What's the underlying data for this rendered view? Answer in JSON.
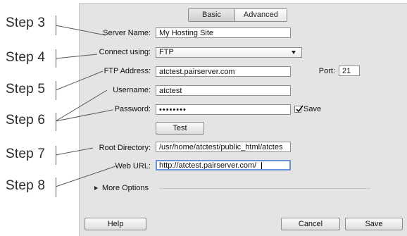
{
  "steps": [
    "Step 3",
    "Step 4",
    "Step 5",
    "Step 6",
    "Step 7",
    "Step 8"
  ],
  "tabs": {
    "basic": "Basic",
    "advanced": "Advanced"
  },
  "form": {
    "server_name_label": "Server Name:",
    "server_name_value": "My Hosting Site",
    "connect_using_label": "Connect using:",
    "connect_using_value": "FTP",
    "ftp_address_label": "FTP Address:",
    "ftp_address_value": "atctest.pairserver.com",
    "port_label": "Port:",
    "port_value": "21",
    "username_label": "Username:",
    "username_value": "atctest",
    "password_label": "Password:",
    "password_value": "••••••••",
    "save_label": "Save",
    "save_checked": true,
    "test_button": "Test",
    "root_directory_label": "Root Directory:",
    "root_directory_value": "/usr/home/atctest/public_html/atctes",
    "web_url_label": "Web URL:",
    "web_url_value": "http://atctest.pairserver.com/",
    "more_options_label": "More Options"
  },
  "footer": {
    "help_button": "Help",
    "cancel_button": "Cancel",
    "save_button": "Save"
  },
  "icons": {
    "dropdown": "chevron-down-icon",
    "disclosure": "disclosure-triangle-icon",
    "checkmark": "checkmark-icon"
  }
}
